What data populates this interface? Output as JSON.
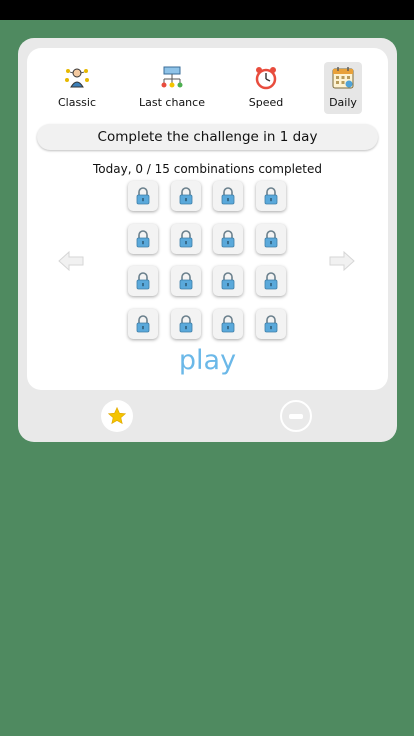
{
  "tabs": [
    {
      "label": "Classic",
      "icon": "person-network-icon",
      "active": false
    },
    {
      "label": "Last chance",
      "icon": "flowchart-icon",
      "active": false
    },
    {
      "label": "Speed",
      "icon": "alarm-clock-icon",
      "active": false
    },
    {
      "label": "Daily",
      "icon": "calendar-icon",
      "active": true
    }
  ],
  "challenge": {
    "text": "Complete the challenge in 1 day"
  },
  "progress": {
    "text": "Today, 0 / 15 combinations completed",
    "completed": 0,
    "total": 15
  },
  "grid": {
    "rows": 4,
    "cols": 4,
    "cell_icon": "lock-icon",
    "lock_color": "#5aa9db"
  },
  "nav": {
    "prev_icon": "arrow-left-icon",
    "next_icon": "arrow-right-icon"
  },
  "play": {
    "label": "play",
    "color": "#6bb8e8"
  },
  "bottom": {
    "star_icon": "star-icon",
    "minus_icon": "minus-circle-icon"
  },
  "colors": {
    "background": "#4f8a60",
    "star": "#f4c400"
  }
}
